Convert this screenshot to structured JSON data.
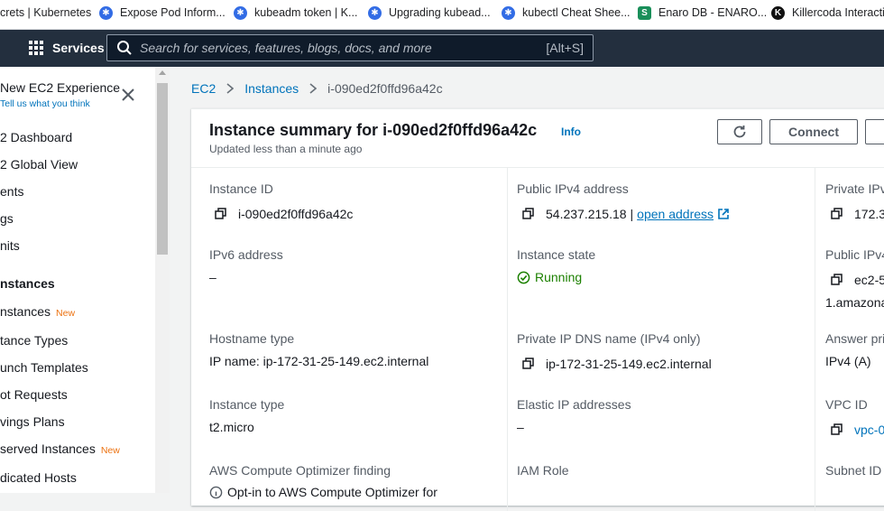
{
  "bookmarks": [
    {
      "label": "crets | Kubernetes",
      "icon": "none"
    },
    {
      "label": "Expose Pod Inform...",
      "icon": "kubernetes-icon"
    },
    {
      "label": "kubeadm token | K...",
      "icon": "kubernetes-icon"
    },
    {
      "label": "Upgrading kubead...",
      "icon": "kubernetes-icon"
    },
    {
      "label": "kubectl Cheat Shee...",
      "icon": "kubernetes-icon"
    },
    {
      "label": "Enaro DB - ENARO...",
      "icon": "sheets-icon"
    },
    {
      "label": "Killercoda Interactiv",
      "icon": "killercoda-icon"
    }
  ],
  "nav": {
    "services_label": "Services",
    "search_placeholder": "Search for services, features, blogs, docs, and more",
    "search_shortcut": "[Alt+S]"
  },
  "sidebar": {
    "title": "New EC2 Experience",
    "subtitle": "Tell us what you think",
    "items": [
      {
        "label": "2 Dashboard"
      },
      {
        "label": "2 Global View"
      },
      {
        "label": "ents"
      },
      {
        "label": "gs"
      },
      {
        "label": "nits"
      },
      {
        "label": "nstances"
      },
      {
        "label": "nstances",
        "badge": "New"
      },
      {
        "label": "tance Types"
      },
      {
        "label": "unch Templates"
      },
      {
        "label": "ot Requests"
      },
      {
        "label": "vings Plans"
      },
      {
        "label": "served Instances",
        "badge": "New"
      },
      {
        "label": "dicated Hosts"
      }
    ]
  },
  "breadcrumb": {
    "items": [
      "EC2",
      "Instances",
      "i-090ed2f0ffd96a42c"
    ]
  },
  "summary": {
    "title": "Instance summary for i-090ed2f0ffd96a42c",
    "info": "Info",
    "updated": "Updated less than a minute ago",
    "connect_label": "Connect",
    "fields": {
      "instance_id_label": "Instance ID",
      "instance_id": "i-090ed2f0ffd96a42c",
      "ipv6_label": "IPv6 address",
      "ipv6": "–",
      "hostname_type_label": "Hostname type",
      "hostname_type": "IP name: ip-172-31-25-149.ec2.internal",
      "instance_type_label": "Instance type",
      "instance_type": "t2.micro",
      "optimizer_label": "AWS Compute Optimizer finding",
      "optimizer_value": "Opt-in to AWS Compute Optimizer for",
      "public_ipv4_label": "Public IPv4 address",
      "public_ipv4": "54.237.215.18",
      "public_ipv4_sep": "|",
      "open_address": "open address",
      "state_label": "Instance state",
      "state": "Running",
      "private_dns_label": "Private IP DNS name (IPv4 only)",
      "private_dns": "ip-172-31-25-149.ec2.internal",
      "elastic_label": "Elastic IP addresses",
      "elastic": "–",
      "iam_label": "IAM Role",
      "private_ipv4_label": "Private IPv",
      "private_ipv4": "172.3",
      "public_dns_label": "Public IPv4",
      "public_dns": "ec2-5",
      "public_dns_cont": "1.amazona",
      "answer_label": "Answer pri",
      "answer": "IPv4 (A)",
      "vpc_label": "VPC ID",
      "vpc": "vpc-0",
      "subnet_label": "Subnet ID"
    }
  },
  "colors": {
    "aws_nav": "#232f3e",
    "link": "#0073bb",
    "running": "#1d8102",
    "new_badge": "#ec7211"
  }
}
